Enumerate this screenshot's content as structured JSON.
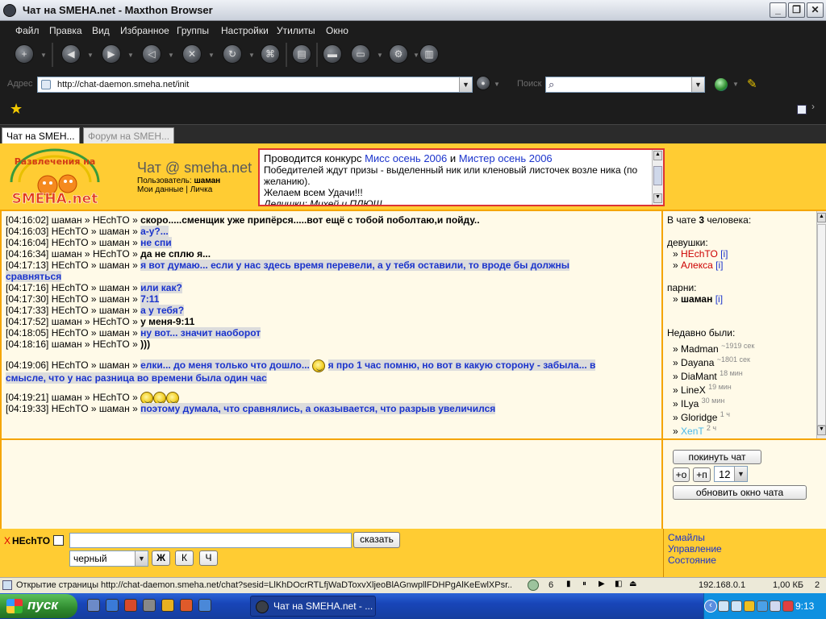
{
  "window": {
    "title": "Чат на SMEHA.net - Maxthon Browser",
    "controls": [
      "_",
      "❐",
      "✕"
    ]
  },
  "menu": [
    "Файл",
    "Правка",
    "Вид",
    "Избранное",
    "Группы",
    "Настройки",
    "Утилиты",
    "Окно"
  ],
  "toolbar_icons": [
    "new-icon",
    "back-icon",
    "forward-icon",
    "back2-icon",
    "stop-icon",
    "refresh-icon",
    "home-icon",
    "page-icon",
    "group-icon",
    "window-icon",
    "tools-icon",
    "sidebar-icon"
  ],
  "address": {
    "label": "Адрес",
    "url": "http://chat-daemon.smeha.net/init",
    "search_label": "Поиск"
  },
  "tabs": [
    {
      "label": "Чат на SMEH...",
      "active": true
    },
    {
      "label": "Форум на SMEH...",
      "active": false
    }
  ],
  "site": {
    "logo_text": "SMEHA.net",
    "logo_arc": "Развлечения на",
    "chat_title": "Чат @ smeha.net",
    "user_label": "Пользователь:",
    "user_name": "шаман",
    "my_data_link": "Мои данные",
    "separator": "|",
    "private_link": "Личка"
  },
  "announcement": {
    "line1_prefix": "Проводится конкурс ",
    "line1_a": "Мисс осень 2006",
    "line1_mid": " и ",
    "line1_b": "Мистер осень 2006",
    "line2": "Победителей ждут призы - выделенный ник или кленовый листочек возле ника (по желанию).",
    "line3": "Желаем всем Удачи!!!",
    "line4": "Делишки: Михей и ПЛЮШ"
  },
  "messages": [
    {
      "time": "[04:16:02]",
      "from": "шаман",
      "to": "HEchTO",
      "text": "скоро.....сменщик уже припёрся.....вот ещё с тобой поболтаю,и пойду..",
      "style": "k"
    },
    {
      "time": "[04:16:03]",
      "from": "HEchTO",
      "to": "шаман",
      "text": "а-у?...",
      "style": "b"
    },
    {
      "time": "[04:16:04]",
      "from": "HEchTO",
      "to": "шаман",
      "text": "не спи",
      "style": "b"
    },
    {
      "time": "[04:16:34]",
      "from": "шаман",
      "to": "HEchTO",
      "text": "да не сплю я...",
      "style": "k"
    },
    {
      "time": "[04:17:13]",
      "from": "HEchTO",
      "to": "шаман",
      "text": "я вот думаю... если у нас здесь время перевели, а у тебя оставили, то вроде бы должны",
      "text2": "сравняться",
      "style": "b"
    },
    {
      "time": "[04:17:16]",
      "from": "HEchTO",
      "to": "шаман",
      "text": "или как?",
      "style": "b"
    },
    {
      "time": "[04:17:30]",
      "from": "HEchTO",
      "to": "шаман",
      "text": "7:11",
      "style": "b"
    },
    {
      "time": "[04:17:33]",
      "from": "HEchTO",
      "to": "шаман",
      "text": "а у тебя?",
      "style": "b"
    },
    {
      "time": "[04:17:52]",
      "from": "шаман",
      "to": "HEchTO",
      "text": "у меня-9:11",
      "style": "k"
    },
    {
      "time": "[04:18:05]",
      "from": "HEchTO",
      "to": "шаман",
      "text": "ну вот... значит наоборот",
      "style": "b"
    },
    {
      "time": "[04:18:16]",
      "from": "шаман",
      "to": "HEchTO",
      "text": ")))",
      "style": "k"
    },
    {
      "time": "[04:19:06]",
      "from": "HEchTO",
      "to": "шаман",
      "text": "елки... до меня только что дошло...",
      "text_after": "я про 1 час помню, но вот в какую сторону - забыла... в",
      "text2": "смысле, что у нас разница во времени была один час",
      "style": "b"
    },
    {
      "time": "[04:19:21]",
      "from": "шаман",
      "to": "HEchTO",
      "text": "",
      "style": "k"
    },
    {
      "time": "[04:19:33]",
      "from": "HEchTO",
      "to": "шаман",
      "text": "поэтому думала, что сравнялись, а оказывается, что разрыв увеличился",
      "style": "b"
    }
  ],
  "users": {
    "in_chat_prefix": "В чате ",
    "in_chat_count": "3",
    "in_chat_suffix": " человека:",
    "girls_label": "девушки:",
    "girls": [
      {
        "name": "HEchTO",
        "info": "[i]"
      },
      {
        "name": "Алекса",
        "info": "[i]"
      }
    ],
    "boys_label": "парни:",
    "boys": [
      {
        "name": "шаман",
        "info": "[i]"
      }
    ],
    "recent_label": "Недавно были:",
    "recent": [
      {
        "name": "Madman",
        "ago": "~1919 сек"
      },
      {
        "name": "Dayana",
        "ago": "~1801 сек"
      },
      {
        "name": "DiaMant",
        "ago": "18 мин"
      },
      {
        "name": "LineX",
        "ago": "19 мин"
      },
      {
        "name": "ILya",
        "ago": "30 мин"
      },
      {
        "name": "Gloridge",
        "ago": "1 ч"
      },
      {
        "name": "XenT",
        "ago": "2 ч"
      }
    ],
    "bullet": "»"
  },
  "controls": {
    "leave": "покинуть чат",
    "plus_o": "+о",
    "plus_p": "+п",
    "font_size": "12",
    "refresh": "обновить окно чата"
  },
  "compose": {
    "remove_mark": "X",
    "recipient": "HEchTO",
    "send": "сказать",
    "color": "черный",
    "bold": "Ж",
    "italic": "К",
    "underline": "Ч"
  },
  "footer_links": [
    "Смайлы",
    "Управление",
    "Состояние"
  ],
  "status": {
    "text": "Открытие страницы http://chat-daemon.smeha.net/chat?sesid=LlKhDOcrRTLfjWaDToxvXljeoBlAGnwpllFDHPgAlKeEwlXPsr...",
    "count": "6",
    "ip": "192.168.0.1",
    "size": "1,00 КБ",
    "num": "2"
  },
  "taskbar": {
    "start": "пуск",
    "task": "Чат на SMEHA.net - ...",
    "clock": "9:13"
  },
  "colors": {
    "page_orange": "#f5a500",
    "header_yellow": "#ffcc33",
    "message_blue": "#1a33cc",
    "girl_red": "#cc0000"
  }
}
